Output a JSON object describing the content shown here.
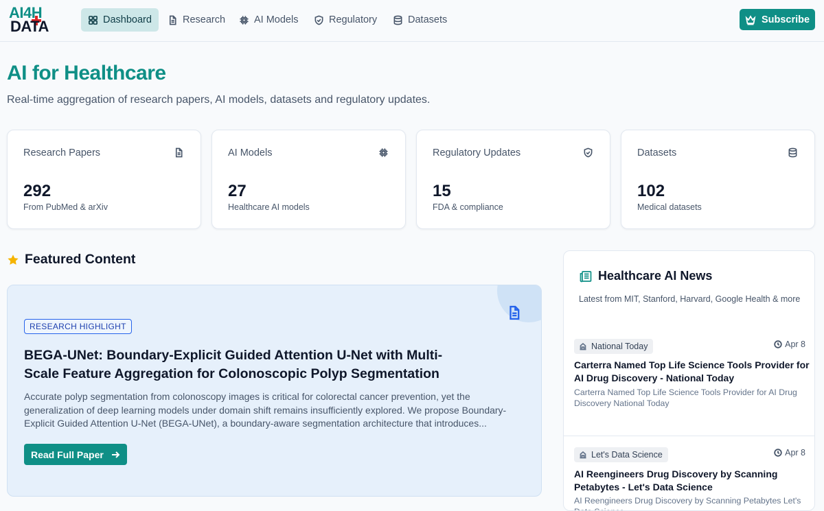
{
  "brand": {
    "line1": "AI4H",
    "line2": "DATA"
  },
  "nav": {
    "items": [
      {
        "label": "Dashboard",
        "icon": "grid-icon",
        "active": true
      },
      {
        "label": "Research",
        "icon": "document-icon"
      },
      {
        "label": "AI Models",
        "icon": "chip-icon"
      },
      {
        "label": "Regulatory",
        "icon": "shield-icon"
      },
      {
        "label": "Datasets",
        "icon": "database-icon"
      }
    ],
    "subscribe_label": "Subscribe"
  },
  "hero": {
    "title": "AI for Healthcare",
    "subtitle": "Real-time aggregation of research papers, AI models, datasets and regulatory updates."
  },
  "stats": [
    {
      "label": "Research Papers",
      "value": "292",
      "desc": "From PubMed & arXiv",
      "icon": "document-icon"
    },
    {
      "label": "AI Models",
      "value": "27",
      "desc": "Healthcare AI models",
      "icon": "chip-icon"
    },
    {
      "label": "Regulatory Updates",
      "value": "15",
      "desc": "FDA & compliance",
      "icon": "shield-icon"
    },
    {
      "label": "Datasets",
      "value": "102",
      "desc": "Medical datasets",
      "icon": "database-icon"
    }
  ],
  "featured": {
    "heading": "Featured Content",
    "badge": "RESEARCH HIGHLIGHT",
    "title": "BEGA-UNet: Boundary-Explicit Guided Attention U-Net with Multi-Scale Feature Aggregation for Colonoscopic Polyp Segmentation",
    "body": "Accurate polyp segmentation from colonoscopy images is critical for colorectal cancer prevention, yet the generalization of deep learning models under domain shift remains insufficiently explored. We propose Boundary-Explicit Guided Attention U-Net (BEGA-UNet), a boundary-aware segmentation architecture that introduces...",
    "button": "Read Full Paper"
  },
  "news": {
    "heading": "Healthcare AI News",
    "subtitle": "Latest from MIT, Stanford, Harvard, Google Health & more",
    "items": [
      {
        "source": "National Today",
        "date": "Apr 8",
        "title": "Carterra Named Top Life Science Tools Provider for AI Drug Discovery - National Today",
        "desc": "Carterra Named Top Life Science Tools Provider for AI Drug Discovery National Today"
      },
      {
        "source": "Let's Data Science",
        "date": "Apr 8",
        "title": "AI Reengineers Drug Discovery by Scanning Petabytes - Let's Data Science",
        "desc": "AI Reengineers Drug Discovery by Scanning Petabytes Let's Data Science"
      }
    ]
  },
  "colors": {
    "accent": "#0f8f86",
    "highlight_bg": "#e6f0fb",
    "badge_blue": "#2563eb"
  }
}
